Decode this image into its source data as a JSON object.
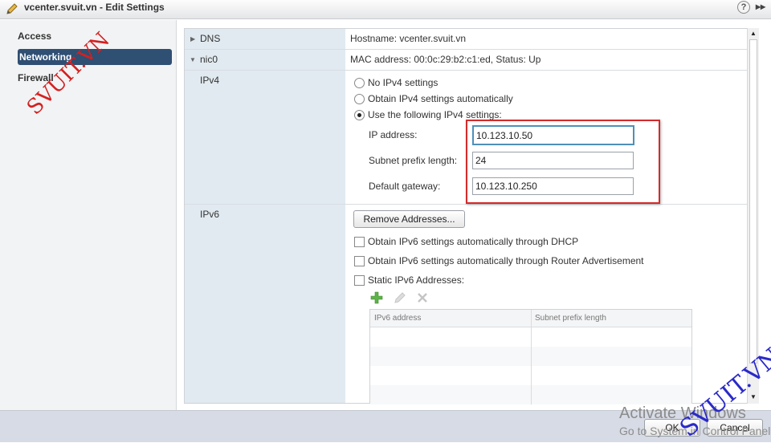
{
  "window": {
    "title": "vcenter.svuit.vn - Edit Settings",
    "help_glyph": "?",
    "expand_glyph": "▸▸"
  },
  "sidebar": {
    "items": [
      {
        "label": "Access",
        "selected": false
      },
      {
        "label": "Networking",
        "selected": true
      },
      {
        "label": "Firewall",
        "selected": false
      }
    ]
  },
  "dns": {
    "label": "DNS",
    "value": "Hostname: vcenter.svuit.vn"
  },
  "nic": {
    "label": "nic0",
    "value": "MAC address: 00:0c:29:b2:c1:ed, Status: Up"
  },
  "ipv4": {
    "label": "IPv4",
    "options": [
      {
        "label": "No IPv4 settings",
        "selected": false
      },
      {
        "label": "Obtain IPv4 settings automatically",
        "selected": false
      },
      {
        "label": "Use the following IPv4 settings:",
        "selected": true
      }
    ],
    "ip_label": "IP address:",
    "ip_value": "10.123.10.50",
    "subnet_label": "Subnet prefix length:",
    "subnet_value": "24",
    "gateway_label": "Default gateway:",
    "gateway_value": "10.123.10.250"
  },
  "ipv6": {
    "label": "IPv6",
    "remove_button": "Remove Addresses...",
    "checkboxes": [
      {
        "label": "Obtain IPv6 settings automatically through DHCP",
        "checked": false
      },
      {
        "label": "Obtain IPv6 settings automatically through Router Advertisement",
        "checked": false
      },
      {
        "label": "Static IPv6 Addresses:",
        "checked": false
      }
    ],
    "table_headers": [
      "IPv6 address",
      "Subnet prefix length"
    ]
  },
  "footer": {
    "ok": "OK",
    "cancel": "Cancel"
  },
  "overlay": {
    "watermark_left": "SVUIT.VN",
    "watermark_right": "SVUIT.VN",
    "activate_line1": "Activate Windows",
    "activate_line2": "Go to System in Control Panel"
  },
  "colors": {
    "selected_nav": "#2f4f73",
    "highlight_box": "#d32b2b",
    "focus_border": "#4f8fb8",
    "watermark_red": "#d42020",
    "watermark_blue": "#2a2ac8"
  }
}
